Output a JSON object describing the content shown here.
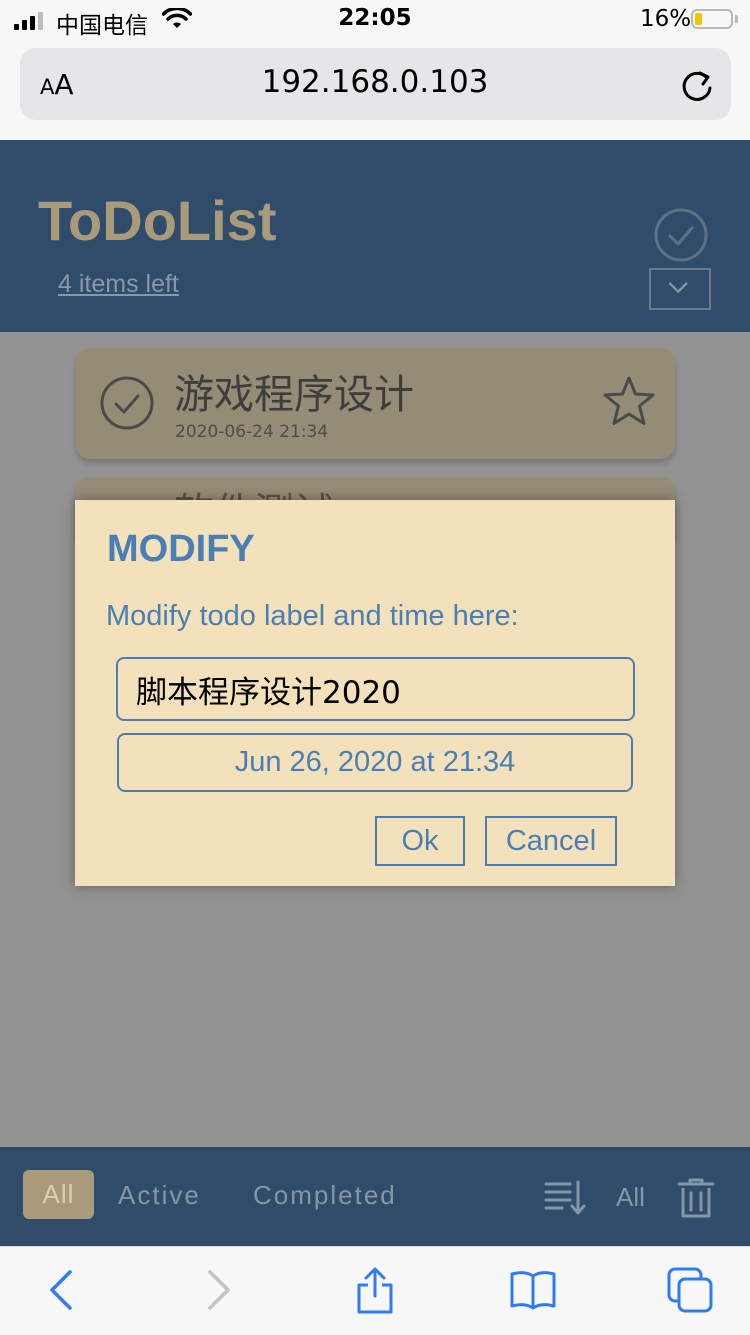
{
  "status_bar": {
    "carrier": "中国电信",
    "time": "22:05",
    "battery_percent": "16%",
    "battery_color": "#f5c400"
  },
  "browser": {
    "text_size_button": "AA",
    "url": "192.168.0.103",
    "reload_icon": "reload-icon"
  },
  "app": {
    "title": "ToDoList",
    "items_left": "4 items left",
    "header_color": "#2f4d6a",
    "accent_color": "#a99b79"
  },
  "todos": [
    {
      "label": "游戏程序设计",
      "time": "2020-06-24 21:34",
      "completed": true,
      "starred": false
    },
    {
      "label": "软件测试",
      "time": "",
      "completed": false,
      "starred": false
    }
  ],
  "modal": {
    "title": "MODIFY",
    "description": "Modify todo label and time here:",
    "label_value": "脚本程序设计2020",
    "date_value": "Jun 26, 2020 at 21:34",
    "ok_label": "Ok",
    "cancel_label": "Cancel"
  },
  "footer": {
    "filters": [
      "All",
      "Active",
      "Completed"
    ],
    "selected_filter": "All",
    "clear_scope_label": "All"
  },
  "toolbar": {
    "icons": [
      "back-icon",
      "forward-icon",
      "share-icon",
      "bookmarks-icon",
      "tabs-icon"
    ]
  }
}
